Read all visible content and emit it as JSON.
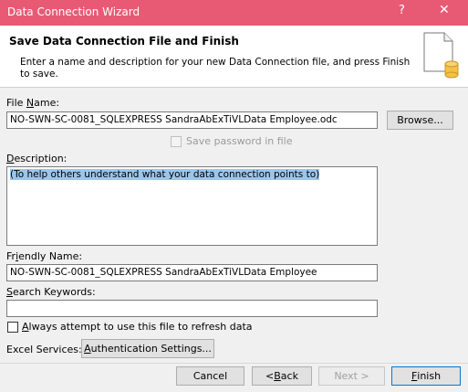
{
  "window": {
    "title": "Data Connection Wizard",
    "help_glyph": "?",
    "close_glyph": "✕"
  },
  "header": {
    "title": "Save Data Connection File and Finish",
    "description": "Enter a name and description for your new Data Connection file, and press Finish to save."
  },
  "file_name": {
    "label_prefix": "File ",
    "label_hotkey": "N",
    "label_suffix": "ame:",
    "value": "NO-SWN-SC-0081_SQLEXPRESS SandraAbExTiVLData Employee.odc",
    "browse_label": "Browse..."
  },
  "save_password": {
    "label": "Save password in file",
    "checked": false,
    "enabled": false
  },
  "description": {
    "label_hotkey": "D",
    "label_suffix": "escription:",
    "value": "(To help others understand what your data connection points to)"
  },
  "friendly_name": {
    "label_prefix": "Fr",
    "label_hotkey": "i",
    "label_suffix": "endly Name:",
    "value": "NO-SWN-SC-0081_SQLEXPRESS SandraAbExTiVLData Employee"
  },
  "search_keywords": {
    "label_hotkey": "S",
    "label_suffix": "earch Keywords:",
    "value": ""
  },
  "always_attempt": {
    "label_hotkey": "A",
    "label_suffix": "lways attempt to use this file to refresh data",
    "checked": false
  },
  "excel_services": {
    "label": "Excel Services:",
    "auth_hotkey": "A",
    "auth_suffix": "uthentication Settings..."
  },
  "footer": {
    "cancel_label": "Cancel",
    "back_prefix": "< ",
    "back_hotkey": "B",
    "back_suffix": "ack",
    "next_label": "Next >",
    "finish_hotkey": "F",
    "finish_suffix": "inish"
  },
  "colors": {
    "titlebar": "#e85a74",
    "selection": "#9cc5ea"
  }
}
